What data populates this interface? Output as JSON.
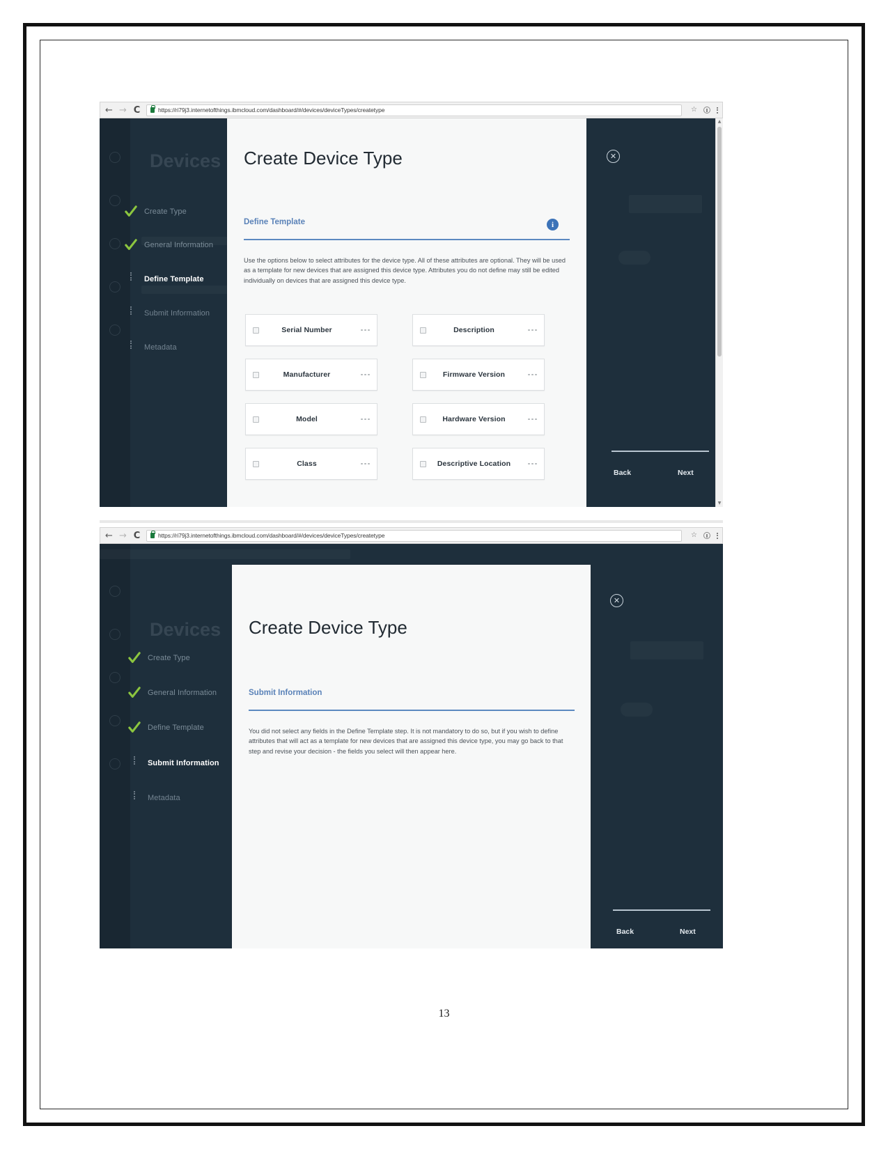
{
  "document": {
    "page_number": "13"
  },
  "browser": {
    "back_icon": "back-arrow-icon",
    "forward_icon": "forward-arrow-icon",
    "reload_icon": "reload-icon",
    "lock_icon": "lock-icon",
    "url": "https://ri79j3.internetofthings.ibmcloud.com/dashboard/#/devices/deviceTypes/createtype",
    "star_icon": "star-icon",
    "extension_icon": "extension-icon",
    "menu_icon": "kebab-menu-icon"
  },
  "window_one": {
    "background_heading": "Devices",
    "modal": {
      "title": "Create Device Type",
      "section_label": "Define Template",
      "info_icon_label": "i",
      "description": "Use the options below to select attributes for the device type. All of these attributes are optional. They will be used as a template for new devices that are assigned this device type. Attributes you do not define may still be edited individually on devices that are assigned this device type.",
      "attributes": [
        {
          "label": "Serial Number",
          "checked": false
        },
        {
          "label": "Description",
          "checked": false
        },
        {
          "label": "Manufacturer",
          "checked": false
        },
        {
          "label": "Firmware Version",
          "checked": false
        },
        {
          "label": "Model",
          "checked": false
        },
        {
          "label": "Hardware Version",
          "checked": false
        },
        {
          "label": "Class",
          "checked": false
        },
        {
          "label": "Descriptive Location",
          "checked": false
        }
      ]
    },
    "wizard_steps": [
      {
        "label": "Create Type",
        "state": "done"
      },
      {
        "label": "General Information",
        "state": "done"
      },
      {
        "label": "Define Template",
        "state": "active"
      },
      {
        "label": "Submit Information",
        "state": "pending"
      },
      {
        "label": "Metadata",
        "state": "pending"
      }
    ],
    "close_label": "✕",
    "back_label": "Back",
    "next_label": "Next"
  },
  "window_two": {
    "background_heading": "Devices",
    "modal": {
      "title": "Create Device Type",
      "section_label": "Submit Information",
      "description": "You did not select any fields in the Define Template step. It is not mandatory to do so, but if you wish to define attributes that will act as a template for new devices that are assigned this device type, you may go back to that step and revise your decision - the fields you select will then appear here."
    },
    "wizard_steps": [
      {
        "label": "Create Type",
        "state": "done"
      },
      {
        "label": "General Information",
        "state": "done"
      },
      {
        "label": "Define Template",
        "state": "done"
      },
      {
        "label": "Submit Information",
        "state": "active"
      },
      {
        "label": "Metadata",
        "state": "pending"
      }
    ],
    "close_label": "✕",
    "back_label": "Back",
    "next_label": "Next"
  },
  "colors": {
    "app_dark": "#1e2f3c",
    "accent_blue": "#5b89c0",
    "check_green": "#8cc63f",
    "modal_bg": "#f7f8f8"
  }
}
